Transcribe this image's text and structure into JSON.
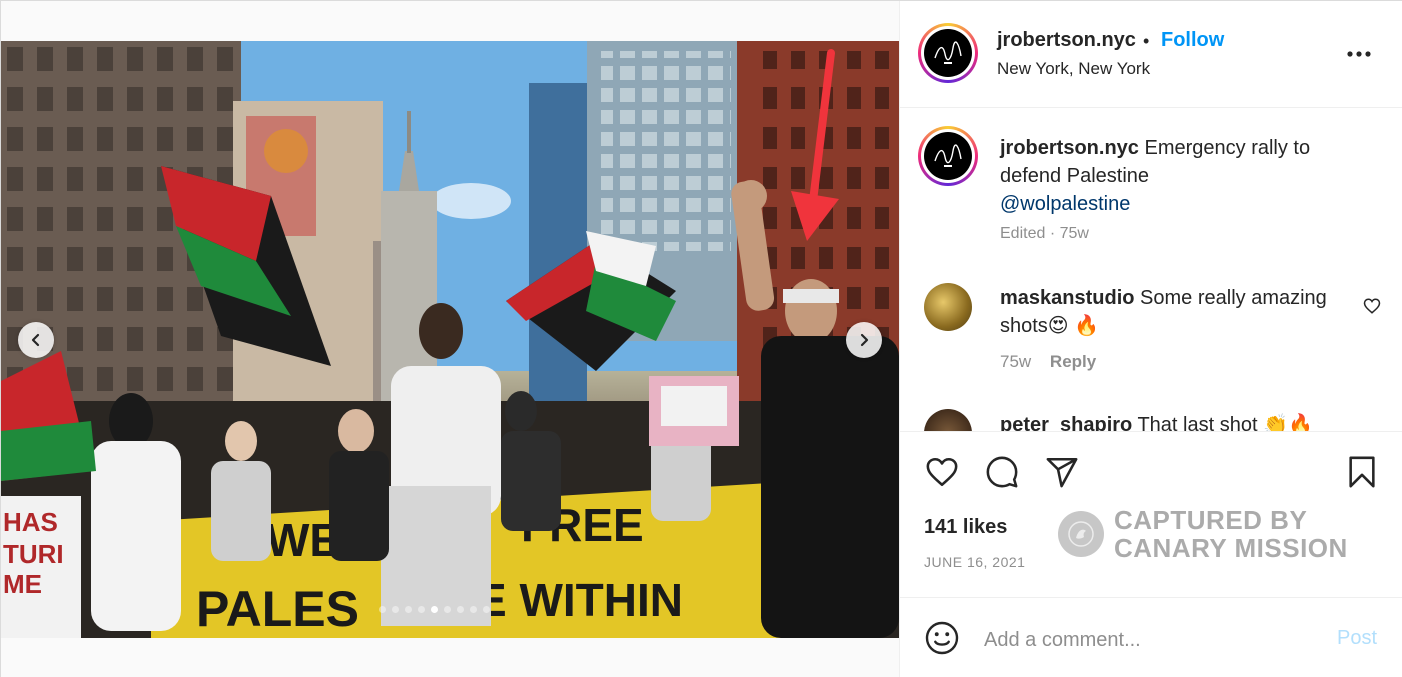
{
  "post": {
    "username": "jrobertson.nyc",
    "separator": "•",
    "follow_label": "Follow",
    "location": "New York, New York",
    "carousel": {
      "slide_count": 9,
      "active_index": 4
    }
  },
  "caption": {
    "username": "jrobertson.nyc",
    "text": "Emergency rally to defend Palestine",
    "mention": "@wolpalestine",
    "meta": "Edited · 75w"
  },
  "comments": [
    {
      "username": "maskanstudio",
      "text": "Some really amazing shots😍 🔥",
      "time": "75w",
      "reply_label": "Reply"
    },
    {
      "username": "peter_shapiro",
      "text": "That last shot 👏🔥"
    }
  ],
  "stats": {
    "likes": "141 likes",
    "date": "JUNE 16, 2021"
  },
  "watermark": {
    "line1": "CAPTURED BY",
    "line2": "CANARY MISSION"
  },
  "composer": {
    "placeholder": "Add a comment...",
    "post_label": "Post"
  },
  "colors": {
    "link": "#0095f6",
    "mention": "#00376b",
    "muted": "#8e8e8e",
    "post_disabled": "#b2dffc",
    "arrow": "#f0343c"
  },
  "icons": {
    "like": "heart-icon",
    "comment": "speech-bubble-icon",
    "share": "paper-plane-icon",
    "save": "bookmark-icon",
    "more": "ellipsis-icon",
    "emoji": "smiley-icon"
  }
}
